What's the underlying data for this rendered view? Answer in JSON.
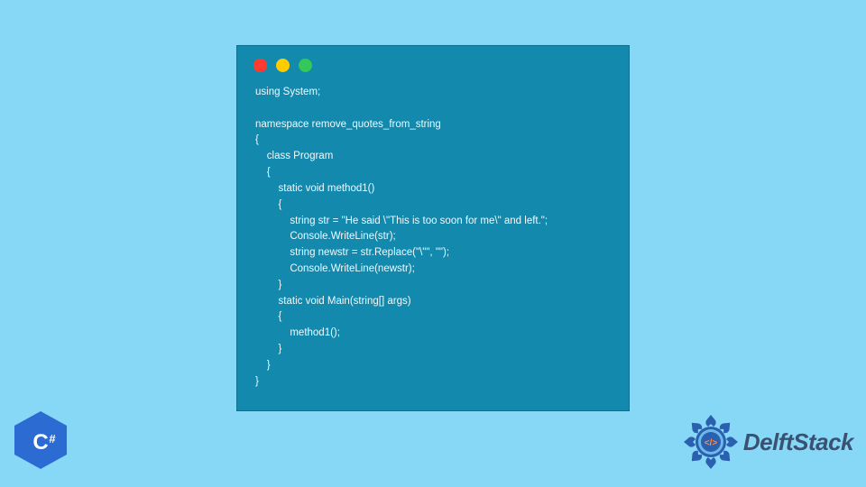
{
  "code": {
    "lines": [
      "using System;",
      "",
      "namespace remove_quotes_from_string",
      "{",
      "    class Program",
      "    {",
      "        static void method1()",
      "        {",
      "            string str = \"He said \\\"This is too soon for me\\\" and left.\";",
      "            Console.WriteLine(str);",
      "            string newstr = str.Replace(\"\\\"\", \"\");",
      "            Console.WriteLine(newstr);",
      "        }",
      "        static void Main(string[] args)",
      "        {",
      "            method1();",
      "        }",
      "    }",
      "}"
    ]
  },
  "branding": {
    "csharp_label": "C#",
    "delftstack_label": "DelftStack"
  },
  "colors": {
    "page_bg": "#87d8f7",
    "window_bg": "#1389ad",
    "code_text": "#eefbff",
    "badge_blue": "#2c6bd1",
    "emblem_blue": "#2b5fb0",
    "brand_text": "#3a5272"
  }
}
